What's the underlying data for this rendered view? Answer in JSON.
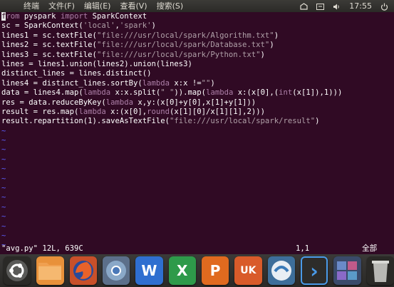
{
  "topbar": {
    "app_name": "终端",
    "menus": [
      "文件(F)",
      "编辑(E)",
      "查看(V)",
      "搜索(S)"
    ],
    "time": "17:55",
    "icons": [
      "network-icon",
      "language-icon",
      "volume-icon",
      "power-icon"
    ]
  },
  "editor": {
    "lines": [
      [
        {
          "t": "f",
          "c": "cursor"
        },
        {
          "t": "rom",
          "c": "kw"
        },
        {
          "t": " pyspark "
        },
        {
          "t": "import",
          "c": "kw"
        },
        {
          "t": " SparkContext"
        }
      ],
      [
        {
          "t": "sc = SparkContext("
        },
        {
          "t": "'local'",
          "c": "str"
        },
        {
          "t": ","
        },
        {
          "t": "'spark'",
          "c": "str"
        },
        {
          "t": ")"
        }
      ],
      [
        {
          "t": "lines1 = sc.textFile("
        },
        {
          "t": "\"file:///usr/local/spark/Algorithm.txt\"",
          "c": "str"
        },
        {
          "t": ")"
        }
      ],
      [
        {
          "t": "lines2 = sc.textFile("
        },
        {
          "t": "\"file:///usr/local/spark/Database.txt\"",
          "c": "str"
        },
        {
          "t": ")"
        }
      ],
      [
        {
          "t": "lines3 = sc.textFile("
        },
        {
          "t": "\"file:///usr/local/spark/Python.txt\"",
          "c": "str"
        },
        {
          "t": ")"
        }
      ],
      [
        {
          "t": "lines = lines1.union(lines2).union(lines3)"
        }
      ],
      [
        {
          "t": "distinct_lines = lines.distinct()"
        }
      ],
      [
        {
          "t": "lines4 = distinct_lines.sortBy("
        },
        {
          "t": "lambda",
          "c": "kw"
        },
        {
          "t": " x:x !="
        },
        {
          "t": "\"\"",
          "c": "str"
        },
        {
          "t": ")"
        }
      ],
      [
        {
          "t": "data = lines4.map("
        },
        {
          "t": "lambda",
          "c": "kw"
        },
        {
          "t": " x:x.split("
        },
        {
          "t": "\" \"",
          "c": "str"
        },
        {
          "t": ")).map("
        },
        {
          "t": "lambda",
          "c": "kw"
        },
        {
          "t": " x:(x[0],("
        },
        {
          "t": "int",
          "c": "kw"
        },
        {
          "t": "(x[1]),1)))"
        }
      ],
      [
        {
          "t": "res = data.reduceByKey("
        },
        {
          "t": "lambda",
          "c": "kw"
        },
        {
          "t": " x,y:(x[0]+y[0],x[1]+y[1]))"
        }
      ],
      [
        {
          "t": "result = res.map("
        },
        {
          "t": "lambda",
          "c": "kw"
        },
        {
          "t": " x:(x[0],"
        },
        {
          "t": "round",
          "c": "kw"
        },
        {
          "t": "(x[1][0]/x[1][1],2)))"
        }
      ],
      [
        {
          "t": "result.repartition(1).saveAsTextFile("
        },
        {
          "t": "\"file:///usr/local/spark/result\"",
          "c": "str"
        },
        {
          "t": ")"
        }
      ]
    ],
    "empty_line_marker": "~",
    "empty_lines": 13
  },
  "statusline": {
    "file_info": "\"avg.py\" 12L, 639C",
    "position": "1,1",
    "scroll": "全部"
  },
  "dock": {
    "items": [
      {
        "name": "ubuntu-logo-icon",
        "bg": "#2a2926",
        "glyph": ""
      },
      {
        "name": "files-icon",
        "bg": "#e8913a",
        "glyph": ""
      },
      {
        "name": "firefox-icon",
        "bg": "#c8502a",
        "glyph": ""
      },
      {
        "name": "chromium-icon",
        "bg": "#5c6f8a",
        "glyph": ""
      },
      {
        "name": "wps-writer-icon",
        "bg": "#2f6fd0",
        "glyph": "W"
      },
      {
        "name": "wps-spreadsheet-icon",
        "bg": "#2e9a4a",
        "glyph": "X"
      },
      {
        "name": "wps-presentation-icon",
        "bg": "#e06a1f",
        "glyph": "P"
      },
      {
        "name": "software-center-icon",
        "bg": "#d95b2a",
        "glyph": "UK"
      },
      {
        "name": "system-updater-icon",
        "bg": "#3d6e9a",
        "glyph": ""
      },
      {
        "name": "terminal-icon",
        "bg": "#2d2c2a",
        "glyph": "›"
      },
      {
        "name": "workspace-switcher-icon",
        "bg": "#3a4a6a",
        "glyph": ""
      },
      {
        "name": "trash-icon",
        "bg": "#2a2926",
        "glyph": ""
      }
    ]
  }
}
